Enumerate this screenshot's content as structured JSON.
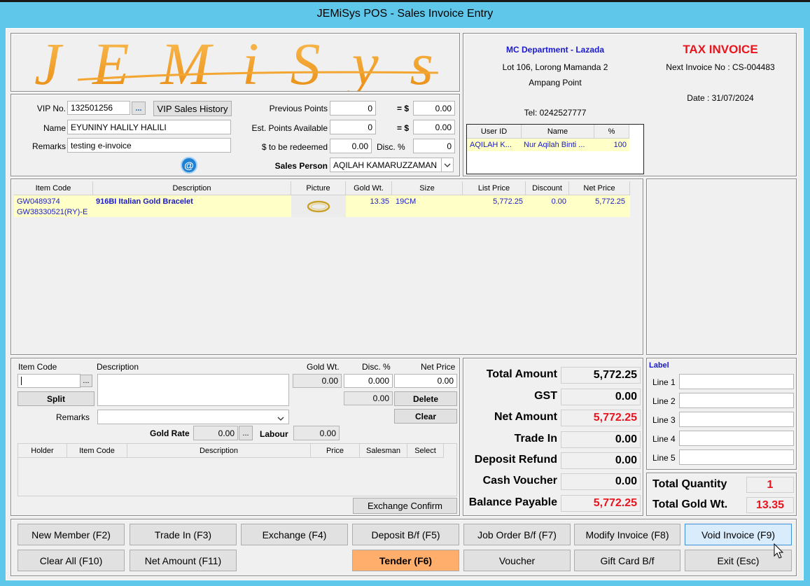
{
  "window": {
    "title": "JEMiSys POS - Sales Invoice Entry"
  },
  "logo": {
    "text": "JEMiSys"
  },
  "store": {
    "name": "MC Department - Lazada",
    "address1": "Lot 106, Lorong Mamanda 2",
    "address2": "Ampang Point",
    "tel": "Tel: 0242527777"
  },
  "invoice": {
    "heading": "TAX INVOICE",
    "next_no": "Next Invoice No : CS-004483",
    "date": "Date : 31/07/2024"
  },
  "users_table": {
    "headers": [
      "User ID",
      "Name",
      "%"
    ],
    "rows": [
      [
        "AQILAH K...",
        "Nur Aqilah Binti ...",
        "100"
      ]
    ]
  },
  "customer": {
    "vip_label": "VIP No.",
    "vip_value": "132501256",
    "vip_dots": "...",
    "vip_history": "VIP Sales History",
    "name_label": "Name",
    "name_value": "EYUNINY HALILY HALILI",
    "remarks_label": "Remarks",
    "remarks_value": "testing e-invoice",
    "email_icon": "@"
  },
  "points": {
    "prev_label": "Previous Points",
    "prev_value": "0",
    "eq1": "= $",
    "prev_dollar": "0.00",
    "est_label": "Est. Points Available",
    "est_value": "0",
    "eq2": "= $",
    "est_dollar": "0.00",
    "redeem_label": "$ to be redeemed",
    "redeem_value": "0.00",
    "disc_label": "Disc. %",
    "disc_value": "0",
    "sales_label": "Sales Person",
    "sales_value": "AQILAH KAMARUZZAMAN"
  },
  "items_table": {
    "headers": [
      "Item Code",
      "Description",
      "Picture",
      "Gold Wt.",
      "Size",
      "List Price",
      "Discount",
      "Net Price"
    ],
    "rows": [
      {
        "code1": "GW0489374",
        "code2": "GW38330521(RY)-E",
        "desc": "916BI Italian Gold Bracelet",
        "gold": "13.35",
        "size": "19CM",
        "list": "5,772.25",
        "disc": "0.00",
        "net": "5,772.25"
      }
    ]
  },
  "entry": {
    "item_code_label": "Item Code",
    "desc_label": "Description",
    "gold_label": "Gold Wt.",
    "disc_label": "Disc. %",
    "net_label": "Net Price",
    "gold_value": "0.00",
    "disc_value": "0.000",
    "net_value": "0.00",
    "disc2_value": "0.00",
    "split": "Split",
    "delete": "Delete",
    "clear": "Clear",
    "remarks_label": "Remarks",
    "gold_rate_label": "Gold Rate",
    "gold_rate_value": "0.00",
    "labour_label": "Labour",
    "labour_value": "0.00",
    "dots": "..."
  },
  "exchange_table": {
    "headers": [
      "Holder",
      "Item Code",
      "Description",
      "Price",
      "Salesman",
      "Select"
    ],
    "confirm": "Exchange Confirm"
  },
  "totals": {
    "total_amount_label": "Total Amount",
    "total_amount": "5,772.25",
    "gst_label": "GST",
    "gst": "0.00",
    "net_amount_label": "Net Amount",
    "net_amount": "5,772.25",
    "trade_in_label": "Trade In",
    "trade_in": "0.00",
    "deposit_label": "Deposit Refund",
    "deposit": "0.00",
    "cash_voucher_label": "Cash Voucher",
    "cash_voucher": "0.00",
    "balance_label": "Balance Payable",
    "balance": "5,772.25"
  },
  "labels_panel": {
    "title": "Label",
    "lines": [
      "Line 1",
      "Line 2",
      "Line 3",
      "Line 4",
      "Line 5"
    ]
  },
  "summary": {
    "qty_label": "Total Quantity",
    "qty": "1",
    "gold_label": "Total Gold Wt.",
    "gold": "13.35"
  },
  "fkeys": {
    "row1": [
      "New Member (F2)",
      "Trade In (F3)",
      "Exchange (F4)",
      "Deposit B/f (F5)",
      "Job Order B/f (F7)",
      "Modify Invoice (F8)",
      "Void Invoice (F9)"
    ],
    "row2": [
      "Clear All (F10)",
      "Net Amount (F11)",
      "Tender (F6)",
      "Voucher",
      "Gift Card B/f",
      "Exit (Esc)"
    ]
  },
  "colors": {
    "accent_red": "#e8141e",
    "accent_blue": "#1a1acc",
    "tender_orange": "#ffae6b",
    "highlight_row": "#ffffc8",
    "void_highlight": "#d9ecfb"
  }
}
